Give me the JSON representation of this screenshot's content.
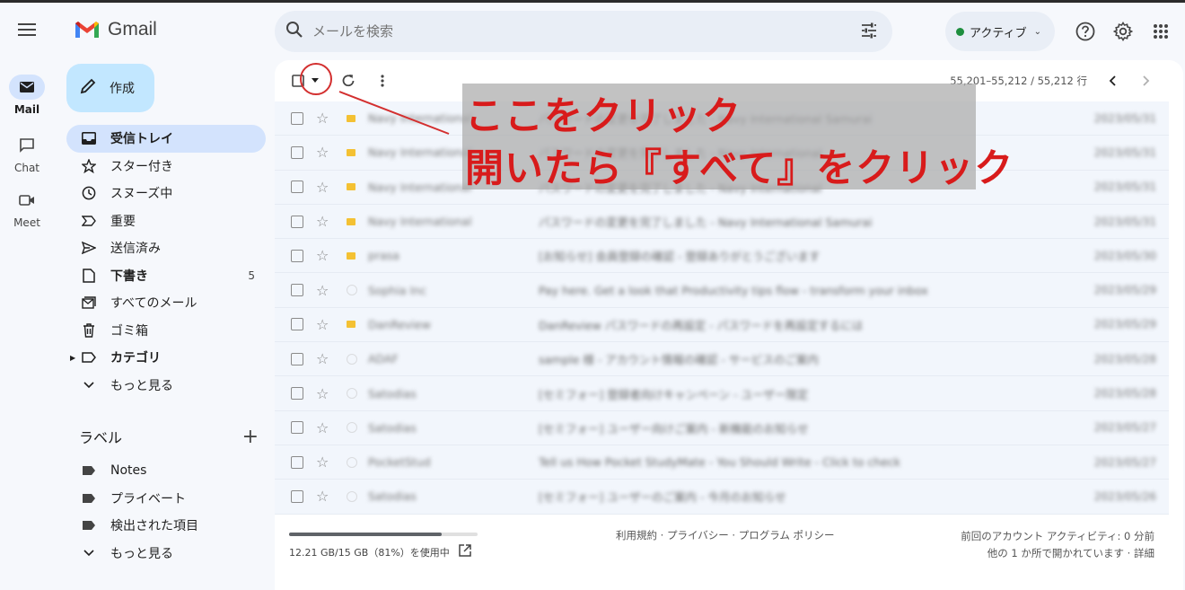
{
  "rail": {
    "items": [
      {
        "label": "Mail"
      },
      {
        "label": "Chat"
      },
      {
        "label": "Meet"
      }
    ]
  },
  "logo": {
    "text": "Gmail"
  },
  "compose": {
    "label": "作成"
  },
  "nav": {
    "items": [
      {
        "label": "受信トレイ",
        "icon": "inbox-icon"
      },
      {
        "label": "スター付き",
        "icon": "star-icon"
      },
      {
        "label": "スヌーズ中",
        "icon": "clock-icon"
      },
      {
        "label": "重要",
        "icon": "important-icon"
      },
      {
        "label": "送信済み",
        "icon": "send-icon"
      },
      {
        "label": "下書き",
        "icon": "draft-icon",
        "count": "5"
      },
      {
        "label": "すべてのメール",
        "icon": "all-mail-icon"
      },
      {
        "label": "ゴミ箱",
        "icon": "trash-icon"
      },
      {
        "label": "カテゴリ",
        "icon": "label-icon"
      },
      {
        "label": "もっと見る",
        "icon": "chevron-down-icon"
      }
    ]
  },
  "labels": {
    "heading": "ラベル",
    "items": [
      {
        "label": "Notes"
      },
      {
        "label": "プライベート"
      },
      {
        "label": "検出された項目"
      },
      {
        "label": "もっと見る"
      }
    ]
  },
  "search": {
    "placeholder": "メールを検索"
  },
  "status": {
    "label": "アクティブ",
    "color": "#1e8e3e"
  },
  "toolbar": {
    "pager": "55,201–55,212 / 55,212 行"
  },
  "rows": [
    {
      "sender": "Navy International",
      "subject": "パスワードの変更を完了しました - Navy International Samurai",
      "date": "2023/05/31",
      "important": true
    },
    {
      "sender": "Navy International",
      "subject": "パスワードの変更を完了しました - Navy International",
      "date": "2023/05/31",
      "important": true
    },
    {
      "sender": "Navy International",
      "subject": "パスワードの変更を完了しました - Navy International",
      "date": "2023/05/31",
      "important": true
    },
    {
      "sender": "Navy International",
      "subject": "パスワードの変更を完了しました - Navy International Samurai",
      "date": "2023/05/31",
      "important": true
    },
    {
      "sender": "prasa",
      "subject": "[お知らせ] 会員登録の確認 - 登録ありがとうございます",
      "date": "2023/05/30",
      "important": true
    },
    {
      "sender": "Sophia Inc",
      "subject": "Pay here. Get a look that Productivity tips flow - transform your inbox",
      "date": "2023/05/29",
      "important": false
    },
    {
      "sender": "DanReview",
      "subject": "DanReview パスワードの再設定 - パスワードを再設定するには",
      "date": "2023/05/29",
      "important": true
    },
    {
      "sender": "ADAF",
      "subject": "sample 様 - アカウント情報の確認 - サービスのご案内",
      "date": "2023/05/28",
      "important": false
    },
    {
      "sender": "Satodias",
      "subject": "[セミフォー] 登録者向けキャンペーン - ユーザー限定",
      "date": "2023/05/28",
      "important": false
    },
    {
      "sender": "Satodias",
      "subject": "[セミフォー] ユーザー向けご案内 - 新機能のお知らせ",
      "date": "2023/05/27",
      "important": false
    },
    {
      "sender": "PocketStud",
      "subject": "Tell us How Pocket StudyMate - You Should Write - Click to check",
      "date": "2023/05/27",
      "important": false
    },
    {
      "sender": "Satodias",
      "subject": "[セミフォー] ユーザーのご案内 - 今月のお知らせ",
      "date": "2023/05/26",
      "important": false
    }
  ],
  "storage": {
    "text": "12.21 GB/15 GB（81%）を使用中",
    "fraction": 0.81
  },
  "footer": {
    "links": "利用規約 · プライバシー · プログラム ポリシー",
    "activity": "前回のアカウント アクティビティ: 0 分前",
    "other": "他の 1 か所で開かれています · 詳細"
  },
  "annotation": {
    "line1": "ここをクリック",
    "line2": "開いたら『すべて』をクリック",
    "color": "#d81b1b"
  }
}
